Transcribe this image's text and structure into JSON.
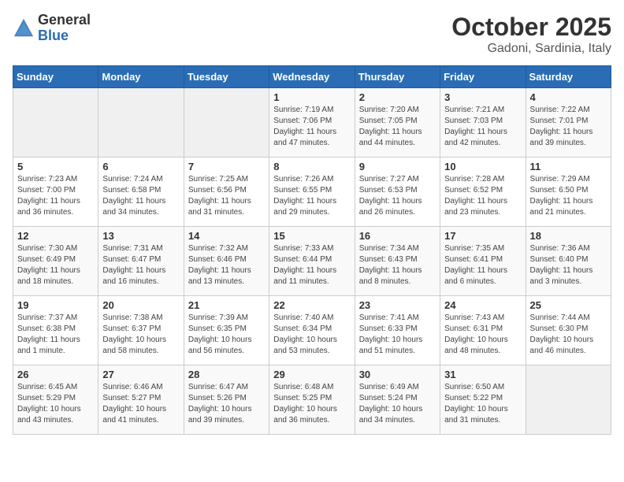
{
  "logo": {
    "general": "General",
    "blue": "Blue"
  },
  "header": {
    "title": "October 2025",
    "subtitle": "Gadoni, Sardinia, Italy"
  },
  "weekdays": [
    "Sunday",
    "Monday",
    "Tuesday",
    "Wednesday",
    "Thursday",
    "Friday",
    "Saturday"
  ],
  "weeks": [
    [
      {
        "day": "",
        "info": ""
      },
      {
        "day": "",
        "info": ""
      },
      {
        "day": "",
        "info": ""
      },
      {
        "day": "1",
        "info": "Sunrise: 7:19 AM\nSunset: 7:06 PM\nDaylight: 11 hours\nand 47 minutes."
      },
      {
        "day": "2",
        "info": "Sunrise: 7:20 AM\nSunset: 7:05 PM\nDaylight: 11 hours\nand 44 minutes."
      },
      {
        "day": "3",
        "info": "Sunrise: 7:21 AM\nSunset: 7:03 PM\nDaylight: 11 hours\nand 42 minutes."
      },
      {
        "day": "4",
        "info": "Sunrise: 7:22 AM\nSunset: 7:01 PM\nDaylight: 11 hours\nand 39 minutes."
      }
    ],
    [
      {
        "day": "5",
        "info": "Sunrise: 7:23 AM\nSunset: 7:00 PM\nDaylight: 11 hours\nand 36 minutes."
      },
      {
        "day": "6",
        "info": "Sunrise: 7:24 AM\nSunset: 6:58 PM\nDaylight: 11 hours\nand 34 minutes."
      },
      {
        "day": "7",
        "info": "Sunrise: 7:25 AM\nSunset: 6:56 PM\nDaylight: 11 hours\nand 31 minutes."
      },
      {
        "day": "8",
        "info": "Sunrise: 7:26 AM\nSunset: 6:55 PM\nDaylight: 11 hours\nand 29 minutes."
      },
      {
        "day": "9",
        "info": "Sunrise: 7:27 AM\nSunset: 6:53 PM\nDaylight: 11 hours\nand 26 minutes."
      },
      {
        "day": "10",
        "info": "Sunrise: 7:28 AM\nSunset: 6:52 PM\nDaylight: 11 hours\nand 23 minutes."
      },
      {
        "day": "11",
        "info": "Sunrise: 7:29 AM\nSunset: 6:50 PM\nDaylight: 11 hours\nand 21 minutes."
      }
    ],
    [
      {
        "day": "12",
        "info": "Sunrise: 7:30 AM\nSunset: 6:49 PM\nDaylight: 11 hours\nand 18 minutes."
      },
      {
        "day": "13",
        "info": "Sunrise: 7:31 AM\nSunset: 6:47 PM\nDaylight: 11 hours\nand 16 minutes."
      },
      {
        "day": "14",
        "info": "Sunrise: 7:32 AM\nSunset: 6:46 PM\nDaylight: 11 hours\nand 13 minutes."
      },
      {
        "day": "15",
        "info": "Sunrise: 7:33 AM\nSunset: 6:44 PM\nDaylight: 11 hours\nand 11 minutes."
      },
      {
        "day": "16",
        "info": "Sunrise: 7:34 AM\nSunset: 6:43 PM\nDaylight: 11 hours\nand 8 minutes."
      },
      {
        "day": "17",
        "info": "Sunrise: 7:35 AM\nSunset: 6:41 PM\nDaylight: 11 hours\nand 6 minutes."
      },
      {
        "day": "18",
        "info": "Sunrise: 7:36 AM\nSunset: 6:40 PM\nDaylight: 11 hours\nand 3 minutes."
      }
    ],
    [
      {
        "day": "19",
        "info": "Sunrise: 7:37 AM\nSunset: 6:38 PM\nDaylight: 11 hours\nand 1 minute."
      },
      {
        "day": "20",
        "info": "Sunrise: 7:38 AM\nSunset: 6:37 PM\nDaylight: 10 hours\nand 58 minutes."
      },
      {
        "day": "21",
        "info": "Sunrise: 7:39 AM\nSunset: 6:35 PM\nDaylight: 10 hours\nand 56 minutes."
      },
      {
        "day": "22",
        "info": "Sunrise: 7:40 AM\nSunset: 6:34 PM\nDaylight: 10 hours\nand 53 minutes."
      },
      {
        "day": "23",
        "info": "Sunrise: 7:41 AM\nSunset: 6:33 PM\nDaylight: 10 hours\nand 51 minutes."
      },
      {
        "day": "24",
        "info": "Sunrise: 7:43 AM\nSunset: 6:31 PM\nDaylight: 10 hours\nand 48 minutes."
      },
      {
        "day": "25",
        "info": "Sunrise: 7:44 AM\nSunset: 6:30 PM\nDaylight: 10 hours\nand 46 minutes."
      }
    ],
    [
      {
        "day": "26",
        "info": "Sunrise: 6:45 AM\nSunset: 5:29 PM\nDaylight: 10 hours\nand 43 minutes."
      },
      {
        "day": "27",
        "info": "Sunrise: 6:46 AM\nSunset: 5:27 PM\nDaylight: 10 hours\nand 41 minutes."
      },
      {
        "day": "28",
        "info": "Sunrise: 6:47 AM\nSunset: 5:26 PM\nDaylight: 10 hours\nand 39 minutes."
      },
      {
        "day": "29",
        "info": "Sunrise: 6:48 AM\nSunset: 5:25 PM\nDaylight: 10 hours\nand 36 minutes."
      },
      {
        "day": "30",
        "info": "Sunrise: 6:49 AM\nSunset: 5:24 PM\nDaylight: 10 hours\nand 34 minutes."
      },
      {
        "day": "31",
        "info": "Sunrise: 6:50 AM\nSunset: 5:22 PM\nDaylight: 10 hours\nand 31 minutes."
      },
      {
        "day": "",
        "info": ""
      }
    ]
  ]
}
